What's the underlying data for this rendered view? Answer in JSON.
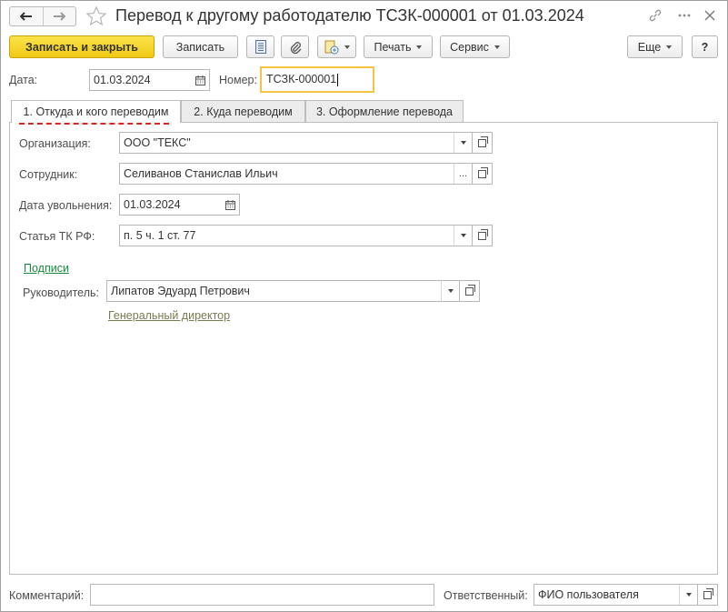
{
  "window": {
    "title": "Перевод к другому работодателю ТСЗК-000001 от 01.03.2024"
  },
  "toolbar": {
    "save_close_label": "Записать и закрыть",
    "save_label": "Записать",
    "print_label": "Печать",
    "service_label": "Сервис",
    "more_label": "Еще",
    "help_label": "?"
  },
  "header": {
    "date_label": "Дата:",
    "date_value": "01.03.2024",
    "number_label": "Номер:",
    "number_value": "ТСЗК-000001"
  },
  "tabs": [
    {
      "label": "1. Откуда и кого переводим",
      "active": true
    },
    {
      "label": "2. Куда переводим",
      "active": false
    },
    {
      "label": "3. Оформление перевода",
      "active": false
    }
  ],
  "form": {
    "org_label": "Организация:",
    "org_value": "ООО \"ТЕКС\"",
    "employee_label": "Сотрудник:",
    "employee_value": "Селиванов Станислав Ильич",
    "dismissal_label": "Дата увольнения:",
    "dismissal_value": "01.03.2024",
    "article_label": "Статья ТК РФ:",
    "article_value": "п. 5 ч. 1 ст. 77",
    "signatures_link": "Подписи",
    "manager_label": "Руководитель:",
    "manager_value": "Липатов Эдуард Петрович",
    "manager_position": "Генеральный директор"
  },
  "footer": {
    "comment_label": "Комментарий:",
    "comment_value": "",
    "responsible_label": "Ответственный:",
    "responsible_value": "ФИО пользователя"
  },
  "colors": {
    "primary_button": "#f5d22a",
    "active_field_border": "#f2c442",
    "tab_underline": "#d8261c",
    "link_green": "#188a3c"
  }
}
